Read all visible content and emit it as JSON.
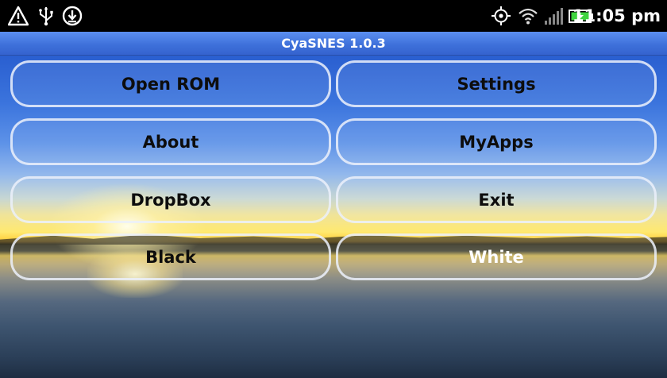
{
  "status_bar": {
    "icons_left": [
      "warning-icon",
      "usb-icon",
      "download-icon"
    ],
    "icons_right": [
      "gps-icon",
      "wifi-icon",
      "signal-icon",
      "battery-charging-icon"
    ],
    "time": "11:05 pm"
  },
  "title_bar": {
    "title": "CyaSNES 1.0.3"
  },
  "menu": {
    "open_rom": "Open ROM",
    "settings": "Settings",
    "about": "About",
    "myapps": "MyApps",
    "dropbox": "DropBox",
    "exit": "Exit",
    "black": "Black",
    "white": "White"
  },
  "colors": {
    "title_bar": "#3d6fd9",
    "status_bar": "#000000",
    "button_border": "#ebf0fa",
    "battery_green": "#3fd43f"
  }
}
